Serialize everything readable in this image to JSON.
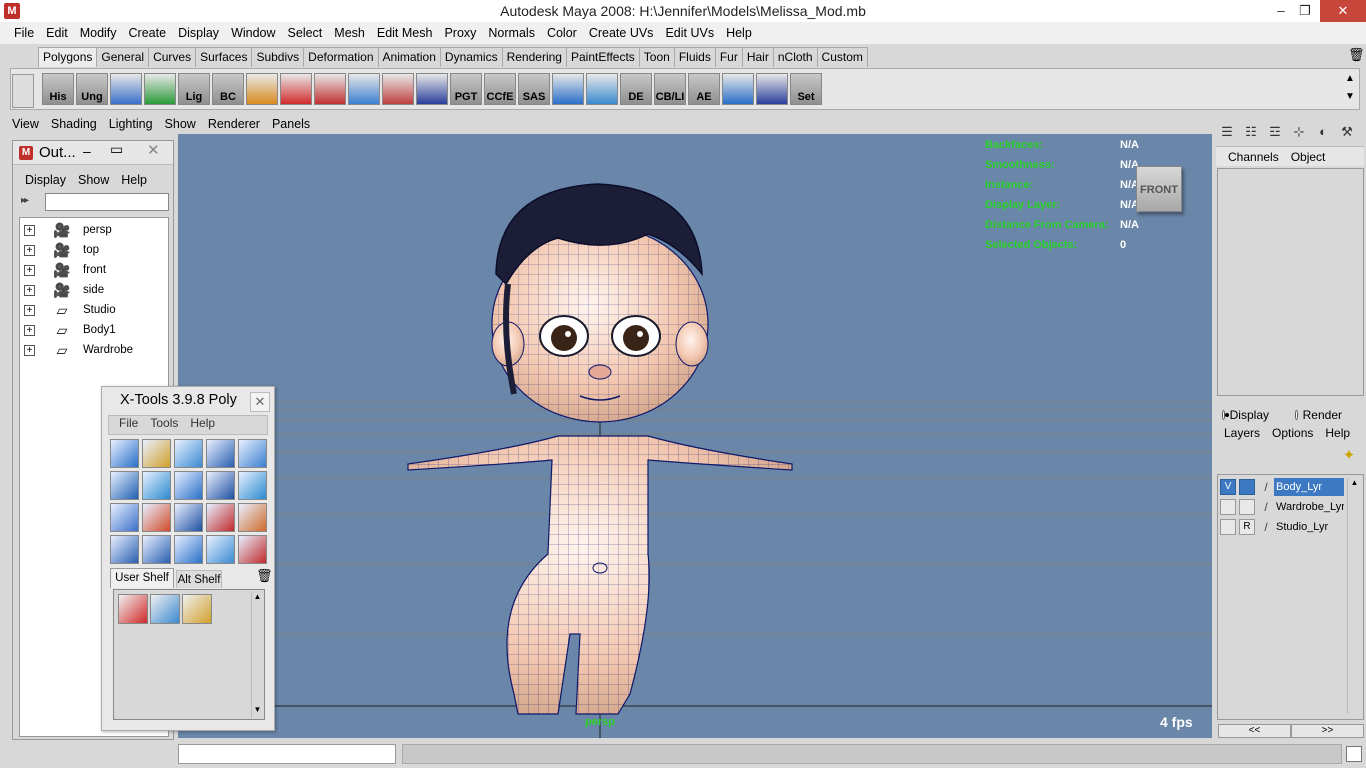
{
  "window": {
    "title": "Autodesk Maya 2008: H:\\Jennifer\\Models\\Melissa_Mod.mb",
    "app_icon": "M",
    "min": "–",
    "max": "❐",
    "close": "✕"
  },
  "menubar": [
    "File",
    "Edit",
    "Modify",
    "Create",
    "Display",
    "Window",
    "Select",
    "Mesh",
    "Edit Mesh",
    "Proxy",
    "Normals",
    "Color",
    "Create UVs",
    "Edit UVs",
    "Help"
  ],
  "shelf": {
    "tabs": [
      "Polygons",
      "General",
      "Curves",
      "Surfaces",
      "Subdivs",
      "Deformation",
      "Animation",
      "Dynamics",
      "Rendering",
      "PaintEffects",
      "Toon",
      "Fluids",
      "Fur",
      "Hair",
      "nCloth",
      "Custom"
    ],
    "active_tab": "Polygons",
    "tools": [
      {
        "label": "His",
        "color": "#b8b8b8"
      },
      {
        "label": "Ung",
        "color": "#b8b8b8"
      },
      {
        "label": "",
        "color": "#3a6fc9"
      },
      {
        "label": "",
        "color": "#2a9a3a"
      },
      {
        "label": "Lig",
        "color": "#b8b8b8"
      },
      {
        "label": "BC",
        "color": "#b8b8b8"
      },
      {
        "label": "",
        "color": "#d98a1e"
      },
      {
        "label": "",
        "color": "#d22b2b"
      },
      {
        "label": "",
        "color": "#c03030"
      },
      {
        "label": "",
        "color": "#3a7fd0"
      },
      {
        "label": "",
        "color": "#c04040"
      },
      {
        "label": "",
        "color": "#2a3f9a"
      },
      {
        "label": "PGT",
        "color": "#b8b8b8"
      },
      {
        "label": "CCfE",
        "color": "#b8b8b8"
      },
      {
        "label": "SAS",
        "color": "#b8b8b8"
      },
      {
        "label": "",
        "color": "#2a6fc9"
      },
      {
        "label": "",
        "color": "#3a8ad0"
      },
      {
        "label": "DE",
        "color": "#2a5fb0"
      },
      {
        "label": "CB/LI",
        "color": "#b8b8b8"
      },
      {
        "label": "AE",
        "color": "#b8b8b8"
      },
      {
        "label": "",
        "color": "#2a6fc9"
      },
      {
        "label": "",
        "color": "#2a3f9a"
      },
      {
        "label": "Set",
        "color": "#b8b8b8"
      }
    ]
  },
  "panel_menu": [
    "View",
    "Shading",
    "Lighting",
    "Show",
    "Renderer",
    "Panels"
  ],
  "hud": [
    {
      "label": "Backfaces:",
      "value": "N/A"
    },
    {
      "label": "Smoothness:",
      "value": "N/A"
    },
    {
      "label": "Instance:",
      "value": "N/A"
    },
    {
      "label": "Display Layer:",
      "value": "N/A"
    },
    {
      "label": "Distance From Camera:",
      "value": "N/A"
    },
    {
      "label": "Selected Objects:",
      "value": "0"
    }
  ],
  "viewcube_label": "FRONT",
  "camera_name": "persp",
  "fps": "4 fps",
  "outliner": {
    "title": "Out...",
    "minimize": "–",
    "maximize": "▭",
    "close": "✕",
    "menu": [
      "Display",
      "Show",
      "Help"
    ],
    "filter_icon": "▸▸",
    "filter_value": "",
    "expand_glyph": "+",
    "items": [
      {
        "label": "persp",
        "icon": "camera-icon",
        "glyph": "🎥"
      },
      {
        "label": "top",
        "icon": "camera-icon",
        "glyph": "🎥"
      },
      {
        "label": "front",
        "icon": "camera-icon",
        "glyph": "🎥"
      },
      {
        "label": "side",
        "icon": "camera-icon",
        "glyph": "🎥"
      },
      {
        "label": "Studio",
        "icon": "transform-icon",
        "glyph": "▱"
      },
      {
        "label": "Body1",
        "icon": "transform-icon",
        "glyph": "▱"
      },
      {
        "label": "Wardrobe",
        "icon": "transform-icon",
        "glyph": "▱"
      }
    ]
  },
  "xtools": {
    "title": "X-Tools 3.9.8 Poly",
    "close": "✕",
    "menu": [
      "File",
      "Tools",
      "Help"
    ],
    "tabs": [
      "User Shelf",
      "Alt Shelf"
    ],
    "trash": "🗑",
    "scroll_up": "▲",
    "scroll_down": "▼",
    "grid_count": 20,
    "shelf_items": [
      {
        "name": "redo-icon",
        "color": "#d02a2a"
      },
      {
        "name": "cone-icon",
        "color": "#3a8ad0"
      },
      {
        "name": "uv-icon",
        "color": "#d0a02a"
      }
    ]
  },
  "right_panel": {
    "icons": [
      "☰",
      "☷",
      "☲",
      "⊹",
      "◐",
      "⚒"
    ],
    "channel_menu": [
      "Channels",
      "Object"
    ],
    "layer_modes": [
      {
        "label": "Display",
        "on": true
      },
      {
        "label": "Render",
        "on": false
      }
    ],
    "layer_menu": [
      "Layers",
      "Options",
      "Help"
    ],
    "new_layer_icon": "✦",
    "layers": [
      {
        "v": "V",
        "p": "",
        "name": "Body_Lyr",
        "selected": true
      },
      {
        "v": "",
        "p": "",
        "name": "Wardrobe_Lyr",
        "selected": false
      },
      {
        "v": "",
        "p": "R",
        "name": "Studio_Lyr",
        "selected": false
      }
    ],
    "nav_prev": "<<",
    "nav_next": ">>"
  },
  "colors": {
    "viewport_bg": "#6a86a8",
    "hud_label": "#2bd12b",
    "selection": "#3d78c2",
    "mesh_wire": "#10186a",
    "skin": "#f2c6ae"
  }
}
